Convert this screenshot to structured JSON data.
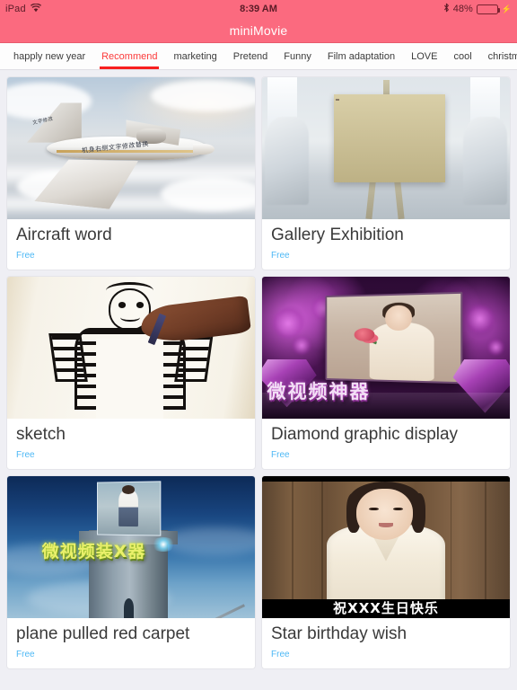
{
  "status_bar": {
    "device": "iPad",
    "wifi_icon": "wifi-icon",
    "time": "8:39 AM",
    "bluetooth_icon": "bluetooth-icon",
    "battery_percent": "48%",
    "battery_level": 48,
    "battery_charging": true,
    "charging_icon": "lightning-bolt-icon"
  },
  "nav": {
    "title": "miniMovie",
    "background_color": "#fb6a7f"
  },
  "tabs": {
    "active_color": "#f81f1f",
    "items": [
      {
        "label": "happly new year",
        "active": false
      },
      {
        "label": "Recommend",
        "active": true
      },
      {
        "label": "marketing",
        "active": false
      },
      {
        "label": "Pretend",
        "active": false
      },
      {
        "label": "Funny",
        "active": false
      },
      {
        "label": "Film adaptation",
        "active": false
      },
      {
        "label": "LOVE",
        "active": false
      },
      {
        "label": "cool",
        "active": false
      },
      {
        "label": "christmas",
        "active": false
      }
    ]
  },
  "grid": {
    "price_color": "#4db8f5",
    "cards": [
      {
        "title": "Aircraft word",
        "price": "Free",
        "thumbnail": "private-jet-above-clouds",
        "overlay_text": "机身右侧文字修改替换",
        "tail_text": "文字修改"
      },
      {
        "title": "Gallery Exhibition",
        "price": "Free",
        "thumbnail": "framed-couple-photo-on-easel-in-gallery"
      },
      {
        "title": "sketch",
        "price": "Free",
        "thumbnail": "hand-drawing-striped-shirt-man-whiteboard-sketch"
      },
      {
        "title": "Diamond graphic display",
        "price": "Free",
        "thumbnail": "purple-diamond-screen-with-bride",
        "overlay_text": "微视频神器"
      },
      {
        "title": "plane pulled red carpet",
        "price": "Free",
        "thumbnail": "stone-tower-photo-in-blue-sky",
        "overlay_text": "微视频装X器"
      },
      {
        "title": "Star birthday wish",
        "price": "Free",
        "thumbnail": "woman-in-white-blouse-wood-panel",
        "overlay_text": "祝XXX生日快乐"
      }
    ]
  }
}
